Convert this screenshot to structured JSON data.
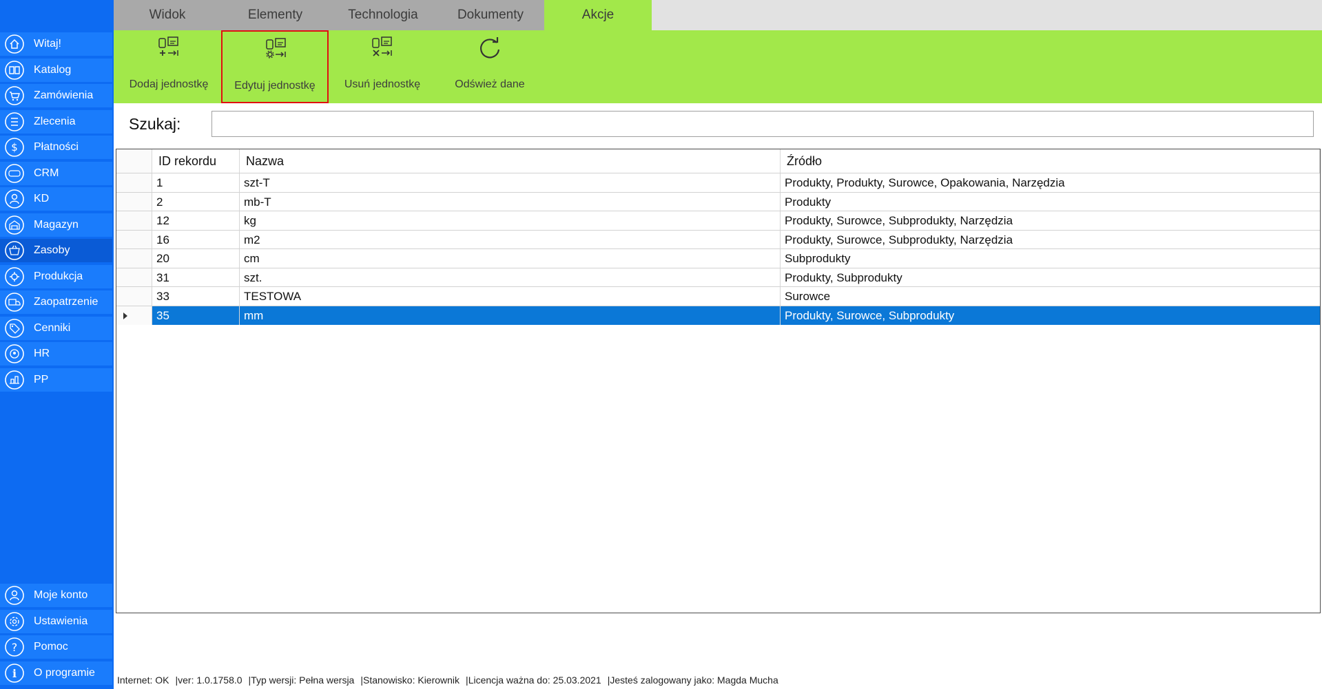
{
  "tabs": [
    {
      "label": "Widok"
    },
    {
      "label": "Elementy"
    },
    {
      "label": "Technologia"
    },
    {
      "label": "Dokumenty"
    },
    {
      "label": "Akcje",
      "active": true
    }
  ],
  "ribbon": {
    "buttons": [
      {
        "label": "Dodaj jednostkę",
        "icon": "add-unit-icon"
      },
      {
        "label": "Edytuj jednostkę",
        "icon": "edit-unit-icon",
        "highlighted": true
      },
      {
        "label": "Usuń jednostkę",
        "icon": "delete-unit-icon"
      },
      {
        "label": "Odśwież dane",
        "icon": "refresh-icon"
      }
    ]
  },
  "sidebar": {
    "items": [
      {
        "label": "Witaj!",
        "icon": "home-icon"
      },
      {
        "label": "Katalog",
        "icon": "book-icon"
      },
      {
        "label": "Zamówienia",
        "icon": "cart-icon"
      },
      {
        "label": "Zlecenia",
        "icon": "list-icon"
      },
      {
        "label": "Płatności",
        "icon": "dollar-icon"
      },
      {
        "label": "CRM",
        "icon": "crm-icon"
      },
      {
        "label": "KD",
        "icon": "user-card-icon"
      },
      {
        "label": "Magazyn",
        "icon": "warehouse-icon"
      },
      {
        "label": "Zasoby",
        "icon": "basket-icon",
        "active": true
      },
      {
        "label": "Produkcja",
        "icon": "production-icon"
      },
      {
        "label": "Zaopatrzenie",
        "icon": "truck-icon"
      },
      {
        "label": "Cenniki",
        "icon": "tag-icon"
      },
      {
        "label": "HR",
        "icon": "hr-icon"
      },
      {
        "label": "PP",
        "icon": "pp-icon"
      }
    ],
    "bottom_items": [
      {
        "label": "Moje konto",
        "icon": "account-icon"
      },
      {
        "label": "Ustawienia",
        "icon": "settings-icon"
      },
      {
        "label": "Pomoc",
        "icon": "help-icon"
      },
      {
        "label": "O programie",
        "icon": "info-icon"
      }
    ]
  },
  "search": {
    "label": "Szukaj:",
    "value": "",
    "placeholder": ""
  },
  "grid": {
    "columns": [
      "ID rekordu",
      "Nazwa",
      "Źródło"
    ],
    "rows": [
      {
        "id": "1",
        "name": "szt-T",
        "source": "Produkty, Produkty, Surowce, Opakowania, Narzędzia"
      },
      {
        "id": "2",
        "name": "mb-T",
        "source": "Produkty"
      },
      {
        "id": "12",
        "name": "kg",
        "source": "Produkty, Surowce, Subprodukty, Narzędzia"
      },
      {
        "id": "16",
        "name": "m2",
        "source": "Produkty, Surowce, Subprodukty, Narzędzia"
      },
      {
        "id": "20",
        "name": "cm",
        "source": "Subprodukty"
      },
      {
        "id": "31",
        "name": "szt.",
        "source": "Produkty, Subprodukty"
      },
      {
        "id": "33",
        "name": "TESTOWA",
        "source": "Surowce"
      },
      {
        "id": "35",
        "name": "mm",
        "source": "Produkty, Surowce, Subprodukty",
        "selected": true
      }
    ]
  },
  "status": {
    "internet": "Internet: OK",
    "version": "ver: 1.0.1758.0",
    "edition": "Typ wersji: Pełna wersja",
    "role": "Stanowisko: Kierownik",
    "license": "Licencja ważna do: 25.03.2021",
    "user": "Jesteś zalogowany jako: Magda Mucha"
  },
  "colors": {
    "sidebar": "#0d6bf2",
    "sidebar_item": "#1a7cfc",
    "ribbon": "#a2e84a",
    "selection": "#0b78d7",
    "highlight_border": "#e01010"
  }
}
